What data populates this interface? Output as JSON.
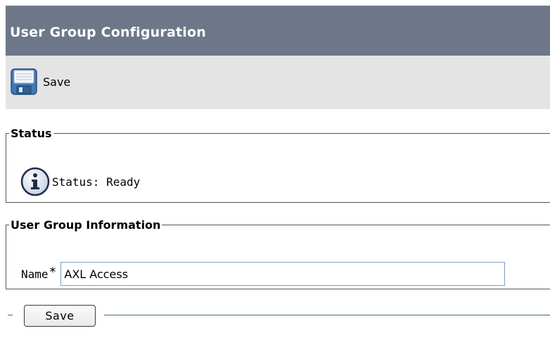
{
  "header": {
    "title": "User Group Configuration"
  },
  "toolbar": {
    "save_label": "Save",
    "save_icon": "floppy-disk-icon"
  },
  "status_section": {
    "legend": "Status",
    "icon": "info-icon",
    "text": "Status: Ready"
  },
  "info_section": {
    "legend": "User Group Information",
    "name_label": "Name",
    "required_marker": "*",
    "name_value": "AXL Access"
  },
  "footer": {
    "save_label": "Save"
  },
  "colors": {
    "title_bar": "#6d7789",
    "toolbar_bg": "#e4e4e4",
    "divider_line": "#3f6e6e"
  }
}
